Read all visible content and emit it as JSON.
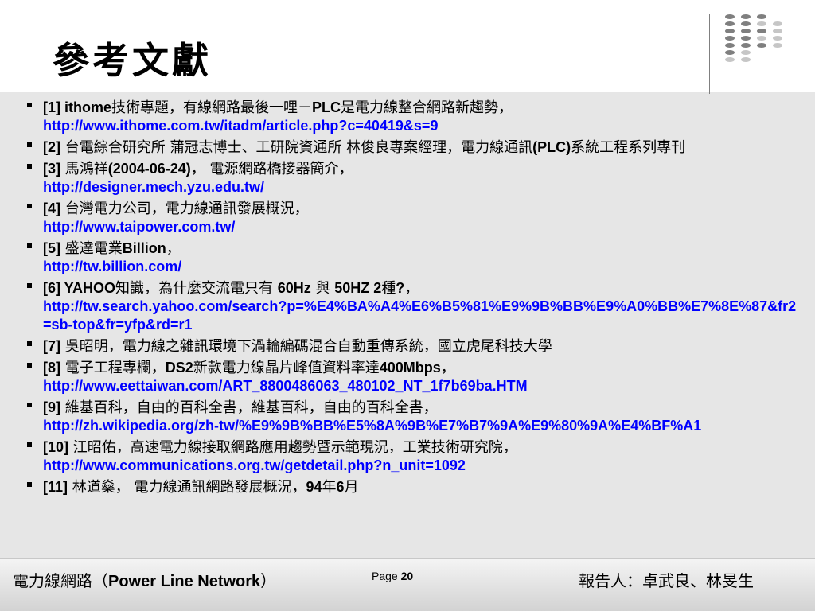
{
  "slide": {
    "title": "參考文獻"
  },
  "colors": {
    "content_bg": "#e6e6e6",
    "link": "#0000ff",
    "dot_dark": "#7f7f7f",
    "dot_light": "#c6c6c6"
  },
  "references": [
    {
      "num": "[1]",
      "segments": [
        {
          "t": "en",
          "v": " ithome"
        },
        {
          "t": "zh",
          "v": "技術專題，有線網路最後一哩－"
        },
        {
          "t": "en",
          "v": "PLC"
        },
        {
          "t": "zh",
          "v": "是電力線整合網路新趨勢，"
        }
      ],
      "link": "http://www.ithome.com.tw/itadm/article.php?c=40419&s=9"
    },
    {
      "num": "[2]",
      "segments": [
        {
          "t": "zh",
          "v": " 台電綜合研究所 蒲冠志博士、工研院資通所 林俊良專案經理，電力線通訊"
        },
        {
          "t": "en",
          "v": "(PLC)"
        },
        {
          "t": "zh",
          "v": "系統工程系列專刊"
        }
      ],
      "link": ""
    },
    {
      "num": "[3]",
      "segments": [
        {
          "t": "zh",
          "v": " 馬鴻祥"
        },
        {
          "t": "en",
          "v": "(2004-06-24)"
        },
        {
          "t": "zh",
          "v": "， 電源網路橋接器簡介，"
        }
      ],
      "link": "http://designer.mech.yzu.edu.tw/"
    },
    {
      "num": "[4]",
      "segments": [
        {
          "t": "zh",
          "v": " 台灣電力公司，電力線通訊發展概況，"
        }
      ],
      "link": "http://www.taipower.com.tw/"
    },
    {
      "num": "[5]",
      "segments": [
        {
          "t": "zh",
          "v": " 盛達電業"
        },
        {
          "t": "en",
          "v": "Billion"
        },
        {
          "t": "zh",
          "v": "，"
        }
      ],
      "link": "http://tw.billion.com/"
    },
    {
      "num": "[6]",
      "segments": [
        {
          "t": "en",
          "v": " YAHOO"
        },
        {
          "t": "zh",
          "v": "知識，為什麼交流電只有 "
        },
        {
          "t": "en",
          "v": "60Hz"
        },
        {
          "t": "zh",
          "v": " 與 "
        },
        {
          "t": "en",
          "v": "50HZ 2"
        },
        {
          "t": "zh",
          "v": "種"
        },
        {
          "t": "en",
          "v": "?"
        },
        {
          "t": "zh",
          "v": "，"
        }
      ],
      "link": "http://tw.search.yahoo.com/search?p=%E4%BA%A4%E6%B5%81%E9%9B%BB%E9%A0%BB%E7%8E%87&fr2=sb-top&fr=yfp&rd=r1"
    },
    {
      "num": "[7]",
      "segments": [
        {
          "t": "zh",
          "v": " 吳昭明，電力線之雜訊環境下渦輪編碼混合自動重傳系統，國立虎尾科技大學"
        }
      ],
      "link": ""
    },
    {
      "num": "[8]",
      "segments": [
        {
          "t": "zh",
          "v": " 電子工程專欄，"
        },
        {
          "t": "en",
          "v": "DS2"
        },
        {
          "t": "zh",
          "v": "新款電力線晶片峰值資料率達"
        },
        {
          "t": "en",
          "v": "400Mbps"
        },
        {
          "t": "zh",
          "v": "，"
        }
      ],
      "link": "http://www.eettaiwan.com/ART_8800486063_480102_NT_1f7b69ba.HTM"
    },
    {
      "num": "[9]",
      "segments": [
        {
          "t": "zh",
          "v": " 維基百科，自由的百科全書，維基百科，自由的百科全書，"
        }
      ],
      "link": "http://zh.wikipedia.org/zh-tw/%E9%9B%BB%E5%8A%9B%E7%B7%9A%E9%80%9A%E4%BF%A1"
    },
    {
      "num": "[10]",
      "segments": [
        {
          "t": "zh",
          "v": " 江昭佑，高速電力線接取網路應用趨勢暨示範現況，工業技術研究院，"
        }
      ],
      "link": "http://www.communications.org.tw/getdetail.php?n_unit=1092"
    },
    {
      "num": "[11]",
      "segments": [
        {
          "t": "zh",
          "v": " 林道燊， 電力線通訊網路發展概況，"
        },
        {
          "t": "en",
          "v": "94"
        },
        {
          "t": "zh",
          "v": "年"
        },
        {
          "t": "en",
          "v": "6"
        },
        {
          "t": "zh",
          "v": "月"
        }
      ],
      "link": ""
    }
  ],
  "footer": {
    "left_zh": "電力線網路（",
    "left_en": "Power Line Network",
    "left_close": "）",
    "page_label": "Page",
    "page_number": "20",
    "right": "報告人：卓武良、林旻生"
  }
}
